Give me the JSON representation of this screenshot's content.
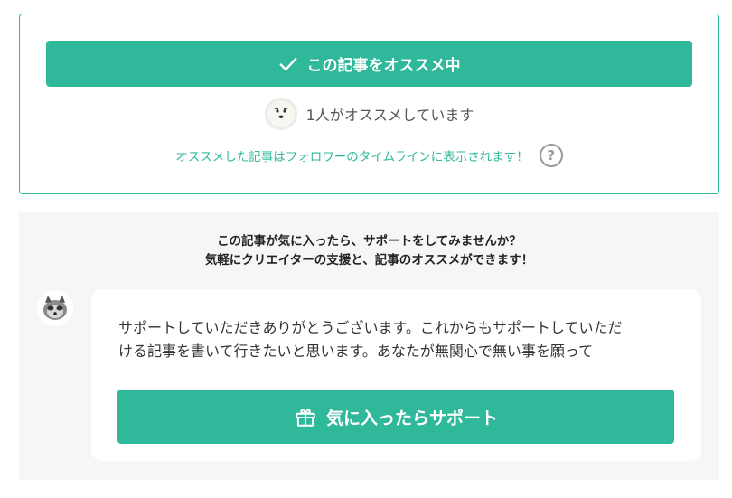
{
  "recommend": {
    "button_label": "この記事をオススメ中",
    "count_text": "1人がオススメしています",
    "info_text": "オススメした記事はフォロワーのタイムラインに表示されます！",
    "help_glyph": "?"
  },
  "support": {
    "headline_line1": "この記事が気に入ったら、サポートをしてみませんか？",
    "headline_line2": "気軽にクリエイターの支援と、記事のオススメができます！",
    "message_line1": "サポートしていただきありがとうございます。これからもサポートしていただ",
    "message_line2": "ける記事を書いて行きたいと思います。あなたが無関心で無い事を願って",
    "button_label": "気に入ったらサポート"
  },
  "colors": {
    "accent": "#2fb899",
    "section_bg": "#f5f7f6"
  },
  "icons": {
    "recommend_button": "check-icon",
    "help": "question-circle-icon",
    "support_button": "gift-icon"
  }
}
